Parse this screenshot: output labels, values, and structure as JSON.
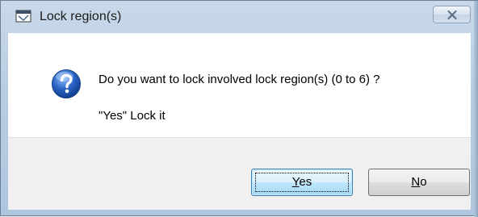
{
  "window": {
    "title": "Lock region(s)",
    "icon": "lock-region-app-icon",
    "close_icon": "close-icon"
  },
  "dialog": {
    "icon": "question-icon",
    "message": "Do you want to lock involved lock region(s) (0 to 6) ?",
    "submessage": "\"Yes\" Lock it"
  },
  "buttons": {
    "yes": {
      "accel": "Y",
      "rest": "es",
      "is_default": true
    },
    "no": {
      "accel": "N",
      "rest": "o",
      "is_default": false
    }
  },
  "colors": {
    "title_bar": "#b9cde2",
    "content_bg": "#ffffff",
    "footer_bg": "#f0f0f0",
    "default_button": "#bee6fd",
    "question_icon": "#2a64c5"
  }
}
